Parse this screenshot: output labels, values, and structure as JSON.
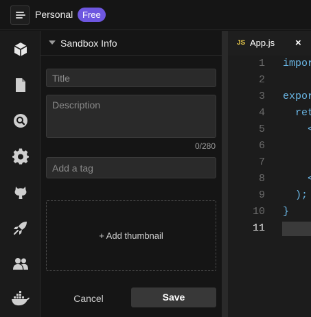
{
  "header": {
    "workspace": "Personal",
    "plan_badge": "Free"
  },
  "activity_bar": {
    "items": [
      "sandbox-info-icon",
      "file-icon",
      "search-icon",
      "gear-icon",
      "github-icon",
      "rocket-icon",
      "users-icon",
      "docker-icon"
    ]
  },
  "sidebar": {
    "title": "Sandbox Info",
    "title_placeholder": "Title",
    "description_placeholder": "Description",
    "char_count": "0/280",
    "tag_placeholder": "Add a tag",
    "thumbnail_label": "+ Add thumbnail",
    "cancel_label": "Cancel",
    "save_label": "Save"
  },
  "editor": {
    "tab_badge": "JS",
    "tab_name": "App.js",
    "tab_close": "×",
    "line_numbers": [
      "1",
      "2",
      "3",
      "4",
      "5",
      "6",
      "7",
      "8",
      "9",
      "10",
      "11"
    ],
    "code_lines": [
      "impor",
      "",
      "expor",
      "  ret",
      "    <",
      "",
      "",
      "    <",
      "  );",
      "}",
      ""
    ]
  },
  "colors": {
    "badge": "#6e57e0",
    "accent_blue": "#6ab7e6",
    "js_yellow": "#e6c84a"
  }
}
